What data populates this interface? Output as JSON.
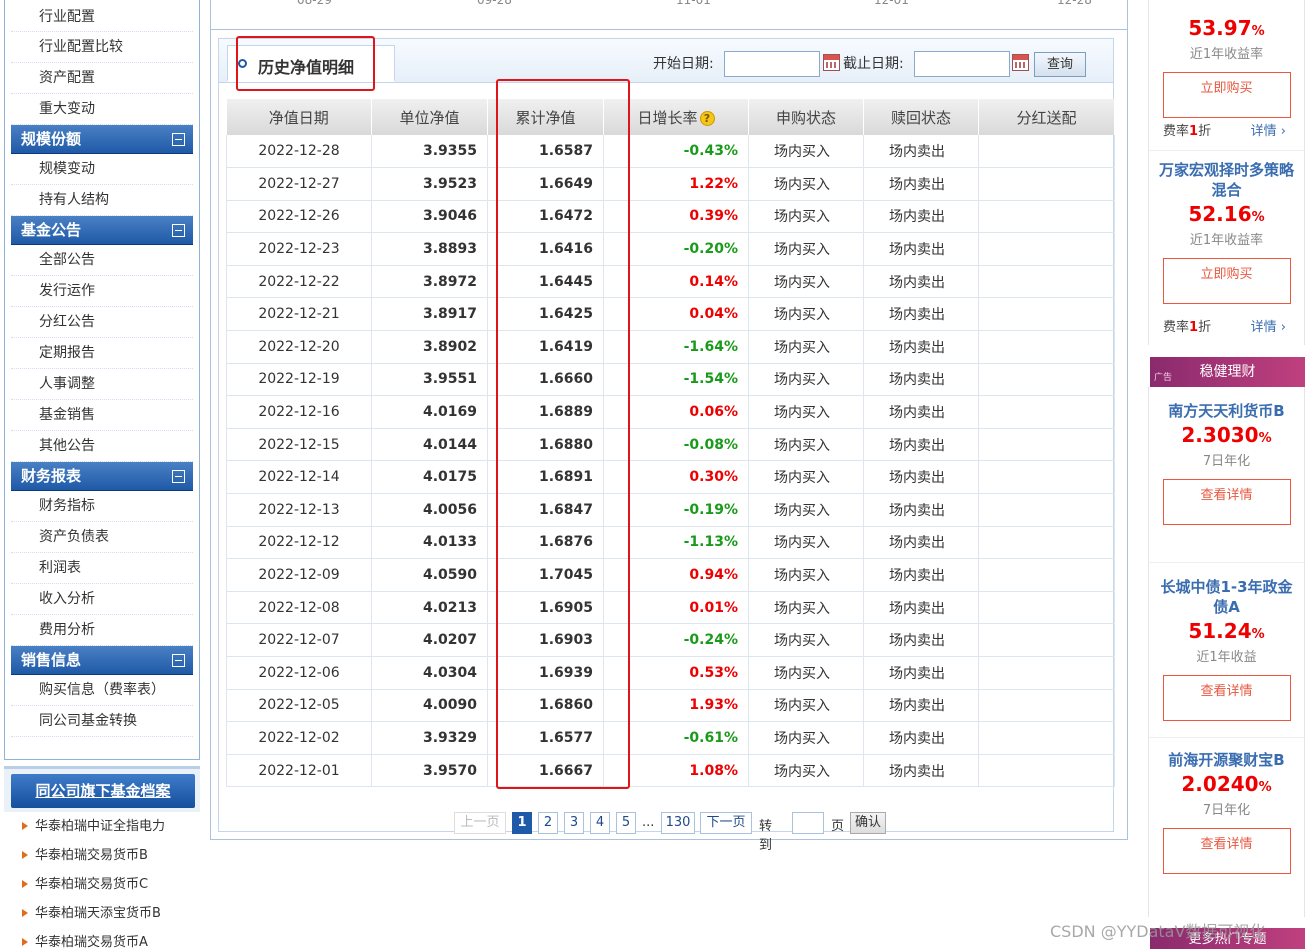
{
  "sidebar": {
    "items_top": [
      "行业配置",
      "行业配置比较",
      "资产配置",
      "重大变动"
    ],
    "section_scale": {
      "title": "规模份额",
      "items": [
        "规模变动",
        "持有人结构"
      ]
    },
    "section_notice": {
      "title": "基金公告",
      "items": [
        "全部公告",
        "发行运作",
        "分红公告",
        "定期报告",
        "人事调整",
        "基金销售",
        "其他公告"
      ]
    },
    "section_finance": {
      "title": "财务报表",
      "items": [
        "财务指标",
        "资产负债表",
        "利润表",
        "收入分析",
        "费用分析"
      ]
    },
    "section_sales": {
      "title": "销售信息",
      "items": [
        "购买信息（费率表）",
        "同公司基金转换"
      ]
    }
  },
  "company_funds": {
    "title": "同公司旗下基金档案",
    "funds": [
      "华泰柏瑞中证全指电力",
      "华泰柏瑞交易货币B",
      "华泰柏瑞交易货币C",
      "华泰柏瑞天添宝货币B",
      "华泰柏瑞交易货币A"
    ]
  },
  "top_axis": [
    "08-29",
    "09-28",
    "11-01",
    "12-01",
    "12-28"
  ],
  "panel": {
    "title": "历史净值明细",
    "start_label": "开始日期:",
    "end_label": "截止日期:",
    "start_value": "",
    "end_value": "",
    "query_label": "查询"
  },
  "table": {
    "headers": [
      "净值日期",
      "单位净值",
      "累计净值",
      "日增长率",
      "申购状态",
      "赎回状态",
      "分红送配"
    ],
    "help_glyph": "?",
    "rows": [
      [
        "2022-12-28",
        "3.9355",
        "1.6587",
        "-0.43%",
        "场内买入",
        "场内卖出",
        ""
      ],
      [
        "2022-12-27",
        "3.9523",
        "1.6649",
        "1.22%",
        "场内买入",
        "场内卖出",
        ""
      ],
      [
        "2022-12-26",
        "3.9046",
        "1.6472",
        "0.39%",
        "场内买入",
        "场内卖出",
        ""
      ],
      [
        "2022-12-23",
        "3.8893",
        "1.6416",
        "-0.20%",
        "场内买入",
        "场内卖出",
        ""
      ],
      [
        "2022-12-22",
        "3.8972",
        "1.6445",
        "0.14%",
        "场内买入",
        "场内卖出",
        ""
      ],
      [
        "2022-12-21",
        "3.8917",
        "1.6425",
        "0.04%",
        "场内买入",
        "场内卖出",
        ""
      ],
      [
        "2022-12-20",
        "3.8902",
        "1.6419",
        "-1.64%",
        "场内买入",
        "场内卖出",
        ""
      ],
      [
        "2022-12-19",
        "3.9551",
        "1.6660",
        "-1.54%",
        "场内买入",
        "场内卖出",
        ""
      ],
      [
        "2022-12-16",
        "4.0169",
        "1.6889",
        "0.06%",
        "场内买入",
        "场内卖出",
        ""
      ],
      [
        "2022-12-15",
        "4.0144",
        "1.6880",
        "-0.08%",
        "场内买入",
        "场内卖出",
        ""
      ],
      [
        "2022-12-14",
        "4.0175",
        "1.6891",
        "0.30%",
        "场内买入",
        "场内卖出",
        ""
      ],
      [
        "2022-12-13",
        "4.0056",
        "1.6847",
        "-0.19%",
        "场内买入",
        "场内卖出",
        ""
      ],
      [
        "2022-12-12",
        "4.0133",
        "1.6876",
        "-1.13%",
        "场内买入",
        "场内卖出",
        ""
      ],
      [
        "2022-12-09",
        "4.0590",
        "1.7045",
        "0.94%",
        "场内买入",
        "场内卖出",
        ""
      ],
      [
        "2022-12-08",
        "4.0213",
        "1.6905",
        "0.01%",
        "场内买入",
        "场内卖出",
        ""
      ],
      [
        "2022-12-07",
        "4.0207",
        "1.6903",
        "-0.24%",
        "场内买入",
        "场内卖出",
        ""
      ],
      [
        "2022-12-06",
        "4.0304",
        "1.6939",
        "0.53%",
        "场内买入",
        "场内卖出",
        ""
      ],
      [
        "2022-12-05",
        "4.0090",
        "1.6860",
        "1.93%",
        "场内买入",
        "场内卖出",
        ""
      ],
      [
        "2022-12-02",
        "3.9329",
        "1.6577",
        "-0.61%",
        "场内买入",
        "场内卖出",
        ""
      ],
      [
        "2022-12-01",
        "3.9570",
        "1.6667",
        "1.08%",
        "场内买入",
        "场内卖出",
        ""
      ]
    ]
  },
  "pager": {
    "prev": "上一页",
    "pages": [
      "1",
      "2",
      "3",
      "4",
      "5"
    ],
    "ellipsis": "...",
    "last": "130",
    "next": "下一页",
    "goto_label": "转到",
    "goto_value": "",
    "page_unit": "页",
    "confirm": "确认"
  },
  "right_ads": {
    "card1": {
      "value": "53.97",
      "pct": "%",
      "sub": "近1年收益率",
      "button": "立即购买",
      "rate_prefix": "费率",
      "rate_num": "1",
      "rate_suffix": "折",
      "detail": "详情"
    },
    "card2": {
      "name": "万家宏观择时多策略混合",
      "value": "52.16",
      "pct": "%",
      "sub": "近1年收益率",
      "button": "立即购买",
      "rate_prefix": "费率",
      "rate_num": "1",
      "rate_suffix": "折",
      "detail": "详情"
    },
    "banner1": {
      "tag": "广告",
      "title": "稳健理财"
    },
    "card3": {
      "name": "南方天天利货币B",
      "value": "2.3030",
      "pct": "%",
      "sub": "7日年化",
      "button": "查看详情"
    },
    "card4": {
      "name": "长城中债1-3年政金债A",
      "value": "51.24",
      "pct": "%",
      "sub": "近1年收益",
      "button": "查看详情"
    },
    "card5": {
      "name": "前海开源聚财宝B",
      "value": "2.0240",
      "pct": "%",
      "sub": "7日年化",
      "button": "查看详情"
    },
    "banner2": {
      "title": "更多热门专题"
    }
  },
  "watermark": "CSDN @YYDataV数据可视化",
  "colors": {
    "up": "#e00000",
    "down": "#1a9a1a",
    "brand_blue": "#1f5aa8",
    "highlight": "#e0151a"
  }
}
